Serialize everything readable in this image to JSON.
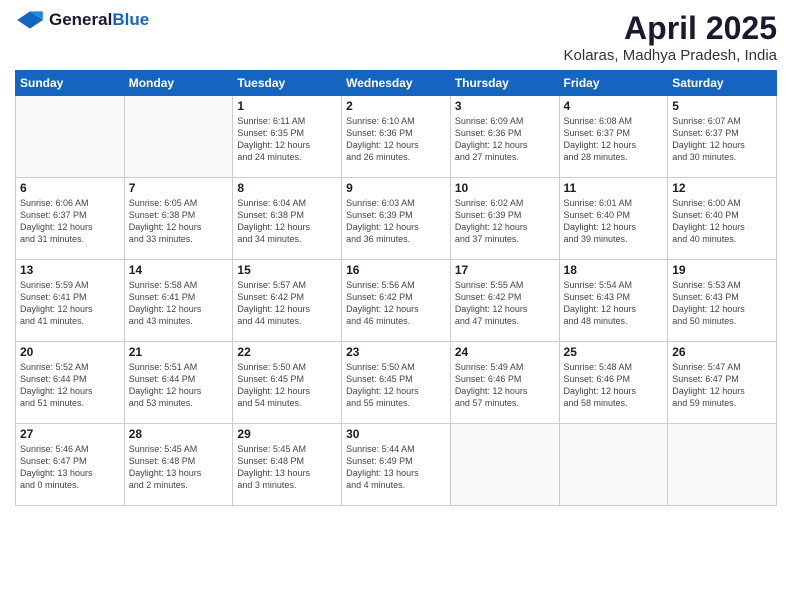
{
  "logo": {
    "general": "General",
    "blue": "Blue"
  },
  "title": {
    "month": "April 2025",
    "location": "Kolaras, Madhya Pradesh, India"
  },
  "days_header": [
    "Sunday",
    "Monday",
    "Tuesday",
    "Wednesday",
    "Thursday",
    "Friday",
    "Saturday"
  ],
  "weeks": [
    [
      {
        "day": "",
        "info": ""
      },
      {
        "day": "",
        "info": ""
      },
      {
        "day": "1",
        "info": "Sunrise: 6:11 AM\nSunset: 6:35 PM\nDaylight: 12 hours\nand 24 minutes."
      },
      {
        "day": "2",
        "info": "Sunrise: 6:10 AM\nSunset: 6:36 PM\nDaylight: 12 hours\nand 26 minutes."
      },
      {
        "day": "3",
        "info": "Sunrise: 6:09 AM\nSunset: 6:36 PM\nDaylight: 12 hours\nand 27 minutes."
      },
      {
        "day": "4",
        "info": "Sunrise: 6:08 AM\nSunset: 6:37 PM\nDaylight: 12 hours\nand 28 minutes."
      },
      {
        "day": "5",
        "info": "Sunrise: 6:07 AM\nSunset: 6:37 PM\nDaylight: 12 hours\nand 30 minutes."
      }
    ],
    [
      {
        "day": "6",
        "info": "Sunrise: 6:06 AM\nSunset: 6:37 PM\nDaylight: 12 hours\nand 31 minutes."
      },
      {
        "day": "7",
        "info": "Sunrise: 6:05 AM\nSunset: 6:38 PM\nDaylight: 12 hours\nand 33 minutes."
      },
      {
        "day": "8",
        "info": "Sunrise: 6:04 AM\nSunset: 6:38 PM\nDaylight: 12 hours\nand 34 minutes."
      },
      {
        "day": "9",
        "info": "Sunrise: 6:03 AM\nSunset: 6:39 PM\nDaylight: 12 hours\nand 36 minutes."
      },
      {
        "day": "10",
        "info": "Sunrise: 6:02 AM\nSunset: 6:39 PM\nDaylight: 12 hours\nand 37 minutes."
      },
      {
        "day": "11",
        "info": "Sunrise: 6:01 AM\nSunset: 6:40 PM\nDaylight: 12 hours\nand 39 minutes."
      },
      {
        "day": "12",
        "info": "Sunrise: 6:00 AM\nSunset: 6:40 PM\nDaylight: 12 hours\nand 40 minutes."
      }
    ],
    [
      {
        "day": "13",
        "info": "Sunrise: 5:59 AM\nSunset: 6:41 PM\nDaylight: 12 hours\nand 41 minutes."
      },
      {
        "day": "14",
        "info": "Sunrise: 5:58 AM\nSunset: 6:41 PM\nDaylight: 12 hours\nand 43 minutes."
      },
      {
        "day": "15",
        "info": "Sunrise: 5:57 AM\nSunset: 6:42 PM\nDaylight: 12 hours\nand 44 minutes."
      },
      {
        "day": "16",
        "info": "Sunrise: 5:56 AM\nSunset: 6:42 PM\nDaylight: 12 hours\nand 46 minutes."
      },
      {
        "day": "17",
        "info": "Sunrise: 5:55 AM\nSunset: 6:42 PM\nDaylight: 12 hours\nand 47 minutes."
      },
      {
        "day": "18",
        "info": "Sunrise: 5:54 AM\nSunset: 6:43 PM\nDaylight: 12 hours\nand 48 minutes."
      },
      {
        "day": "19",
        "info": "Sunrise: 5:53 AM\nSunset: 6:43 PM\nDaylight: 12 hours\nand 50 minutes."
      }
    ],
    [
      {
        "day": "20",
        "info": "Sunrise: 5:52 AM\nSunset: 6:44 PM\nDaylight: 12 hours\nand 51 minutes."
      },
      {
        "day": "21",
        "info": "Sunrise: 5:51 AM\nSunset: 6:44 PM\nDaylight: 12 hours\nand 53 minutes."
      },
      {
        "day": "22",
        "info": "Sunrise: 5:50 AM\nSunset: 6:45 PM\nDaylight: 12 hours\nand 54 minutes."
      },
      {
        "day": "23",
        "info": "Sunrise: 5:50 AM\nSunset: 6:45 PM\nDaylight: 12 hours\nand 55 minutes."
      },
      {
        "day": "24",
        "info": "Sunrise: 5:49 AM\nSunset: 6:46 PM\nDaylight: 12 hours\nand 57 minutes."
      },
      {
        "day": "25",
        "info": "Sunrise: 5:48 AM\nSunset: 6:46 PM\nDaylight: 12 hours\nand 58 minutes."
      },
      {
        "day": "26",
        "info": "Sunrise: 5:47 AM\nSunset: 6:47 PM\nDaylight: 12 hours\nand 59 minutes."
      }
    ],
    [
      {
        "day": "27",
        "info": "Sunrise: 5:46 AM\nSunset: 6:47 PM\nDaylight: 13 hours\nand 0 minutes."
      },
      {
        "day": "28",
        "info": "Sunrise: 5:45 AM\nSunset: 6:48 PM\nDaylight: 13 hours\nand 2 minutes."
      },
      {
        "day": "29",
        "info": "Sunrise: 5:45 AM\nSunset: 6:48 PM\nDaylight: 13 hours\nand 3 minutes."
      },
      {
        "day": "30",
        "info": "Sunrise: 5:44 AM\nSunset: 6:49 PM\nDaylight: 13 hours\nand 4 minutes."
      },
      {
        "day": "",
        "info": ""
      },
      {
        "day": "",
        "info": ""
      },
      {
        "day": "",
        "info": ""
      }
    ]
  ]
}
